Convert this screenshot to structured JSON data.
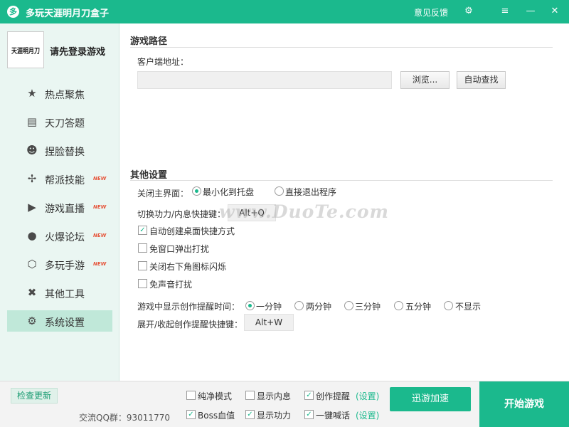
{
  "title_bar": {
    "logo_glyph": "多",
    "app_title": "多玩天涯明月刀盒子",
    "feedback_label": "意见反馈",
    "settings_icon": "⚙",
    "menu_icon": "≡",
    "minimize_icon": "—",
    "close_icon": "✕"
  },
  "sidebar": {
    "avatar_text": "天涯明月刀",
    "login_prompt": "请先登录游戏",
    "items": [
      {
        "label": "热点聚焦",
        "icon": "star-icon",
        "glyph": "★",
        "badge": ""
      },
      {
        "label": "天刀答题",
        "icon": "book-icon",
        "glyph": "▤",
        "badge": ""
      },
      {
        "label": "捏脸替换",
        "icon": "mask-icon",
        "glyph": "☻",
        "badge": ""
      },
      {
        "label": "帮派技能",
        "icon": "pinwheel-icon",
        "glyph": "✢",
        "badge": "NEW"
      },
      {
        "label": "游戏直播",
        "icon": "play-icon",
        "glyph": "▶",
        "badge": "NEW"
      },
      {
        "label": "火爆论坛",
        "icon": "chat-bubble-icon",
        "glyph": "●",
        "badge": "NEW"
      },
      {
        "label": "多玩手游",
        "icon": "shield-icon",
        "glyph": "⬡",
        "badge": "NEW"
      },
      {
        "label": "其他工具",
        "icon": "tools-icon",
        "glyph": "✖",
        "badge": ""
      },
      {
        "label": "系统设置",
        "icon": "gear-icon",
        "glyph": "⚙",
        "badge": "",
        "active": true
      }
    ]
  },
  "game_path": {
    "section_title": "游戏路径",
    "client_address_label": "客户端地址：",
    "client_address_value": "",
    "browse_label": "浏览...",
    "auto_find_label": "自动查找"
  },
  "other_settings": {
    "section_title": "其他设置",
    "close_main_label": "关闭主界面：",
    "close_options": [
      {
        "label": "最小化到托盘",
        "selected": true
      },
      {
        "label": "直接退出程序",
        "selected": false
      }
    ],
    "hotkey_label": "切换功力/内息快捷键：",
    "hotkey_value": "Alt+Q",
    "checkboxes": [
      {
        "label": "自动创建桌面快捷方式",
        "checked": true
      },
      {
        "label": "免窗口弹出打扰",
        "checked": false
      },
      {
        "label": "关闭右下角图标闪烁",
        "checked": false
      },
      {
        "label": "免声音打扰",
        "checked": false
      }
    ],
    "reminder_time_label": "游戏中显示创作提醒时间：",
    "reminder_options": [
      {
        "label": "一分钟",
        "selected": true
      },
      {
        "label": "两分钟",
        "selected": false
      },
      {
        "label": "三分钟",
        "selected": false
      },
      {
        "label": "五分钟",
        "selected": false
      },
      {
        "label": "不显示",
        "selected": false
      }
    ],
    "reminder_hotkey_label": "展开/收起创作提醒快捷键：",
    "reminder_hotkey_value": "Alt+W"
  },
  "bottom_bar": {
    "check_update_label": "检查更新",
    "qq_group_label": "交流QQ群：93011770",
    "options": [
      {
        "label": "纯净模式",
        "checked": false,
        "link": ""
      },
      {
        "label": "显示内息",
        "checked": false,
        "link": ""
      },
      {
        "label": "创作提醒",
        "checked": true,
        "link": "(设置)"
      },
      {
        "label": "Boss血值",
        "checked": true,
        "link": ""
      },
      {
        "label": "显示功力",
        "checked": true,
        "link": ""
      },
      {
        "label": "一键喊话",
        "checked": true,
        "link": "(设置)"
      }
    ],
    "speed_up_label": "迅游加速",
    "start_game_label": "开始游戏"
  },
  "watermark": "www.DuoTe.com",
  "colors": {
    "accent": "#1bb98d",
    "sidebar_bg": "#eaf6f2",
    "badge": "#e6553b"
  }
}
